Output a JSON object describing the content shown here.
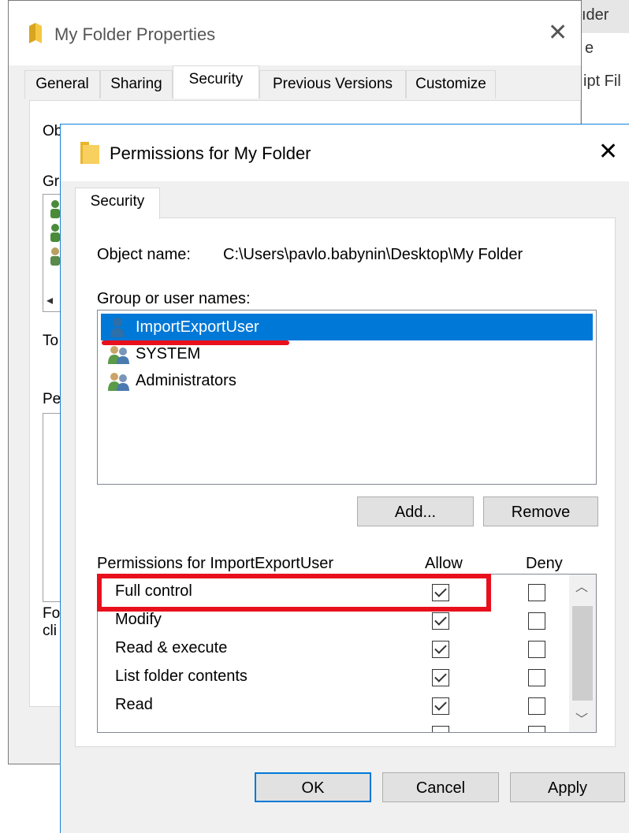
{
  "background": {
    "fragments": [
      "ıder",
      "e",
      "ipt Fil"
    ]
  },
  "back_dialog": {
    "title": "My Folder Properties",
    "tabs": [
      {
        "label": "General"
      },
      {
        "label": "Sharing"
      },
      {
        "label": "Security",
        "active": true
      },
      {
        "label": "Previous Versions"
      },
      {
        "label": "Customize"
      }
    ],
    "fragments": {
      "object": "Obj",
      "group": "Gr",
      "to": "To",
      "permissions": "Pe",
      "for_special_1": "Fo",
      "for_special_2": "cli"
    }
  },
  "dialog": {
    "title": "Permissions for My Folder",
    "tab": "Security",
    "object_name_label": "Object name:",
    "object_name_value": "C:\\Users\\pavlo.babynin\\Desktop\\My Folder",
    "group_label": "Group or user names:",
    "users": [
      {
        "name": "ImportExportUser",
        "icon": "user-icon",
        "selected": true
      },
      {
        "name": "SYSTEM",
        "icon": "users-group-icon",
        "selected": false
      },
      {
        "name": "Administrators",
        "icon": "users-group-icon",
        "selected": false
      }
    ],
    "add_button": "Add...",
    "remove_button": "Remove",
    "permissions_label": "Permissions for ImportExportUser",
    "allow_header": "Allow",
    "deny_header": "Deny",
    "permissions": [
      {
        "name": "Full control",
        "allow": true,
        "deny": false
      },
      {
        "name": "Modify",
        "allow": true,
        "deny": false
      },
      {
        "name": "Read & execute",
        "allow": true,
        "deny": false
      },
      {
        "name": "List folder contents",
        "allow": true,
        "deny": false
      },
      {
        "name": "Read",
        "allow": true,
        "deny": false
      }
    ],
    "ok_button": "OK",
    "cancel_button": "Cancel",
    "apply_button": "Apply"
  },
  "annotations": {
    "color": "#e8101c"
  }
}
